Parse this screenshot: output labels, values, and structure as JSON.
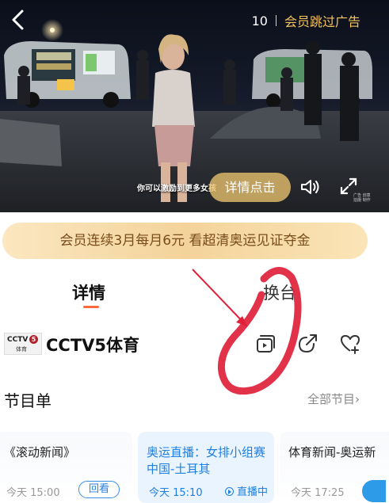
{
  "video": {
    "ad_countdown": "10",
    "ad_skip_label": "会员跳过广告",
    "subtitle": "你可以激励到更多女孩",
    "detail_button_label": "详情点击",
    "watermark": "广告 创意 拍摄 制作"
  },
  "banner": {
    "text": "会员连续3月每月6元 看超清奥运见证夺金"
  },
  "tabs": [
    {
      "label": "详情",
      "active": true
    },
    {
      "label": "换台",
      "active": false
    }
  ],
  "channel": {
    "logo_text": "CCTV",
    "logo_number": "5",
    "logo_sub": "体育",
    "name": "CCTV5体育",
    "icons": [
      "multi-screen-icon",
      "share-icon",
      "follow-icon"
    ]
  },
  "schedule": {
    "title": "节目单",
    "all_link": "全部节目",
    "items": [
      {
        "title": "《滚动新闻》",
        "time": "今天 15:00",
        "action": "回看",
        "status": "past"
      },
      {
        "title": "奥运直播：女排小组赛 中国-土耳其",
        "time": "今天 15:10",
        "action": "直播中",
        "status": "live"
      },
      {
        "title": "体育新闻-奥运新",
        "time": "今天 17:25",
        "action": "",
        "status": "upcoming"
      }
    ]
  },
  "colors": {
    "accent_gold": "#f4c35e",
    "banner_text": "#7a4d1c",
    "live_blue": "#1f7fe0",
    "tab_underline": "#ff6a3d",
    "annotation_red": "#e0213a"
  }
}
